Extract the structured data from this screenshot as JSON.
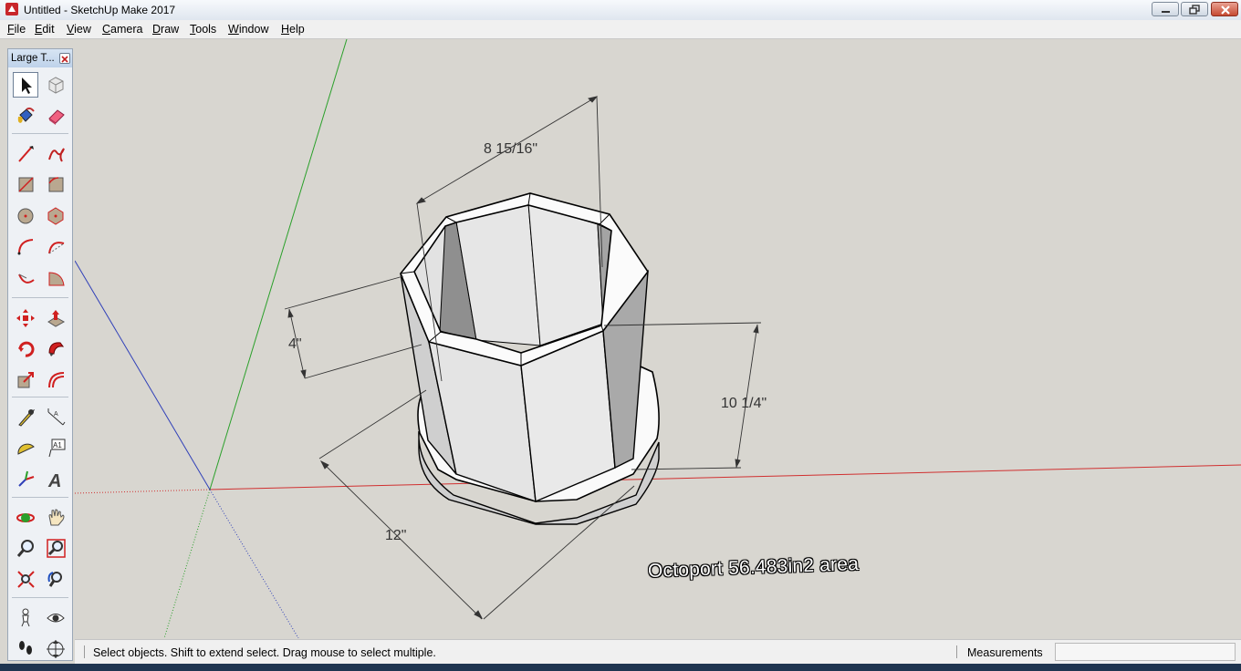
{
  "window": {
    "title": "Untitled - SketchUp Make 2017"
  },
  "menu": [
    {
      "accel": "F",
      "rest": "ile"
    },
    {
      "accel": "E",
      "rest": "dit"
    },
    {
      "accel": "V",
      "rest": "iew"
    },
    {
      "accel": "C",
      "rest": "amera"
    },
    {
      "accel": "D",
      "rest": "raw"
    },
    {
      "accel": "T",
      "rest": "ools"
    },
    {
      "accel": "W",
      "rest": "indow"
    },
    {
      "accel": "H",
      "rest": "elp"
    }
  ],
  "toolbar": {
    "title": "Large T...",
    "tools": [
      {
        "name": "select-tool-icon"
      },
      {
        "name": "make-component-icon"
      },
      {
        "name": "paint-bucket-icon"
      },
      {
        "name": "eraser-icon"
      },
      {
        "name": "line-tool-icon"
      },
      {
        "name": "freehand-icon"
      },
      {
        "name": "rectangle-icon"
      },
      {
        "name": "rotated-rectangle-icon"
      },
      {
        "name": "circle-icon"
      },
      {
        "name": "polygon-icon"
      },
      {
        "name": "arc-icon"
      },
      {
        "name": "two-point-arc-icon"
      },
      {
        "name": "three-point-arc-icon"
      },
      {
        "name": "pie-icon"
      },
      {
        "name": "move-icon"
      },
      {
        "name": "push-pull-icon"
      },
      {
        "name": "rotate-icon"
      },
      {
        "name": "follow-me-icon"
      },
      {
        "name": "scale-icon"
      },
      {
        "name": "offset-icon"
      },
      {
        "name": "tape-measure-icon"
      },
      {
        "name": "dimension-icon"
      },
      {
        "name": "protractor-icon"
      },
      {
        "name": "text-tool-icon"
      },
      {
        "name": "axes-icon"
      },
      {
        "name": "3d-text-icon"
      },
      {
        "name": "orbit-icon"
      },
      {
        "name": "pan-icon"
      },
      {
        "name": "zoom-icon"
      },
      {
        "name": "zoom-window-icon"
      },
      {
        "name": "zoom-extents-icon"
      },
      {
        "name": "previous-view-icon"
      },
      {
        "name": "position-camera-icon"
      },
      {
        "name": "look-around-icon"
      },
      {
        "name": "walk-icon"
      },
      {
        "name": "section-plane-icon"
      }
    ],
    "text_tool_glyph": "A1",
    "three_d_glyph": "A"
  },
  "model": {
    "dimensions": {
      "top_width": "8 15/16\"",
      "base_height": "4\"",
      "tube_height": "10 1/4\"",
      "base_diameter": "12\""
    },
    "label": "Octoport 56.483in2 area"
  },
  "status": {
    "hint": "Select objects. Shift to extend select. Drag mouse to select multiple.",
    "measurements_label": "Measurements",
    "measurements_value": ""
  },
  "colors": {
    "axis_red": "#d03030",
    "axis_green": "#2aa02a",
    "axis_blue": "#3040b8",
    "background": "#d8d6d0"
  }
}
